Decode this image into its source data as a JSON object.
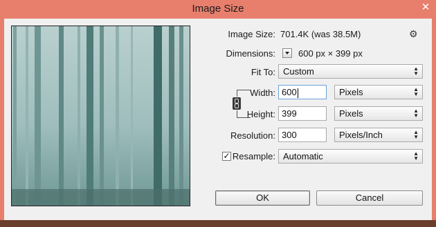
{
  "window": {
    "title": "Image Size",
    "close_glyph": "✕"
  },
  "info": {
    "image_size_label": "Image Size:",
    "image_size_value": "701.4K (was 38.5M)",
    "dimensions_label": "Dimensions:",
    "dimensions_value": "600 px  ×  399 px"
  },
  "fit_to": {
    "label": "Fit To:",
    "value": "Custom"
  },
  "width": {
    "label": "Width:",
    "value": "600",
    "unit": "Pixels"
  },
  "height": {
    "label": "Height:",
    "value": "399",
    "unit": "Pixels"
  },
  "resolution": {
    "label": "Resolution:",
    "value": "300",
    "unit": "Pixels/Inch"
  },
  "resample": {
    "label": "Resample:",
    "checked": true,
    "check_glyph": "✓",
    "value": "Automatic"
  },
  "buttons": {
    "ok": "OK",
    "cancel": "Cancel"
  },
  "icons": {
    "gear": "⚙",
    "select_arrows": "▲▼"
  }
}
